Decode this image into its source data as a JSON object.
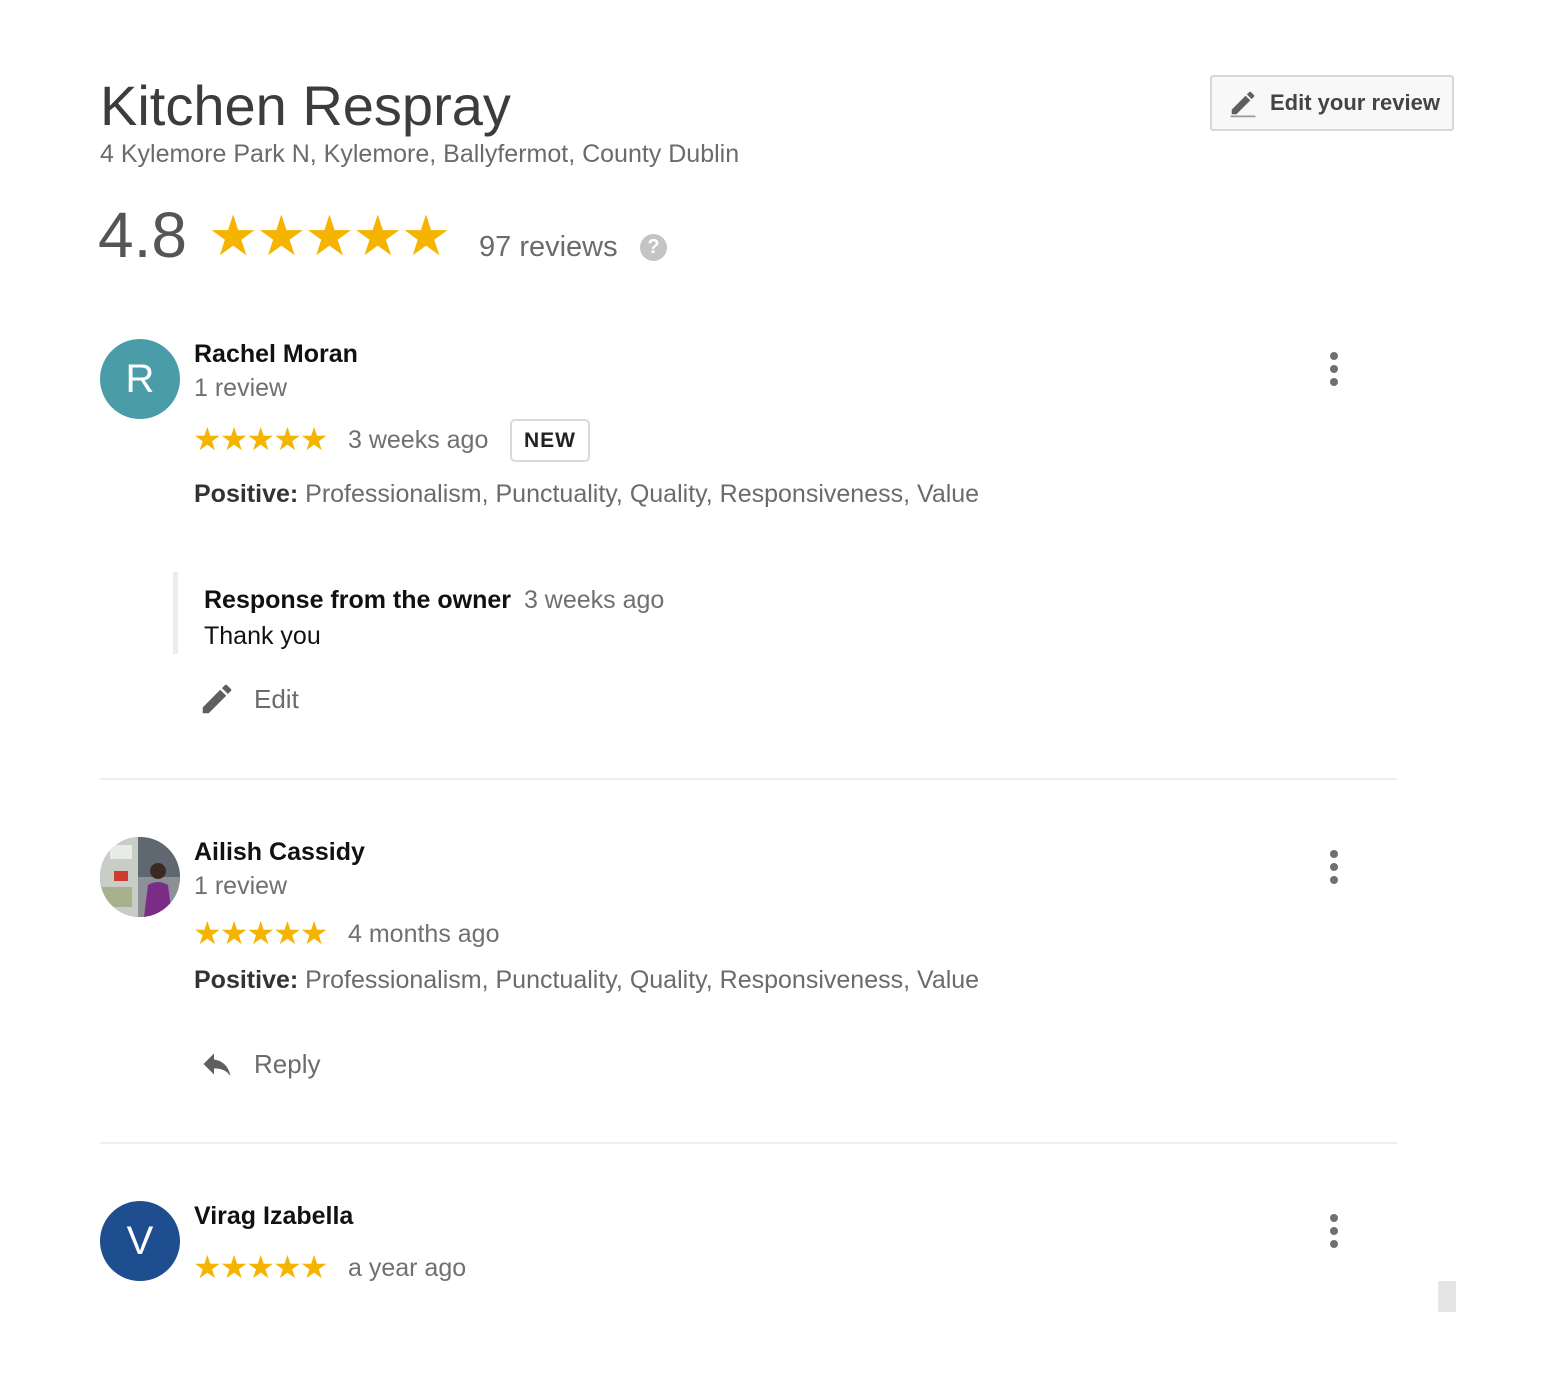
{
  "business": {
    "name": "Kitchen Respray",
    "address": "4 Kylemore Park N, Kylemore, Ballyfermot, County Dublin",
    "rating": "4.8",
    "rating_value": 4.8,
    "stars": "★★★★★",
    "review_count_label": "97 reviews",
    "help_glyph": "?"
  },
  "edit_review_button": {
    "label": "Edit your review",
    "icon": "pencil-icon"
  },
  "colors": {
    "star": "#f4b400",
    "avatar_r": "#4a9da8",
    "avatar_v": "#1e4e8f"
  },
  "reviews": [
    {
      "avatar_letter": "R",
      "name": "Rachel Moran",
      "review_count": "1 review",
      "stars": "★★★★★",
      "time": "3 weeks ago",
      "badge": "NEW",
      "positive_label": "Positive:",
      "positive_items": "Professionalism, Punctuality, Quality, Responsiveness, Value",
      "owner_response": {
        "title": "Response from the owner",
        "time": "3 weeks ago",
        "text": "Thank you"
      },
      "action_label": "Edit"
    },
    {
      "avatar_letter": "",
      "name": "Ailish Cassidy",
      "review_count": "1 review",
      "stars": "★★★★★",
      "time": "4 months ago",
      "positive_label": "Positive:",
      "positive_items": "Professionalism, Punctuality, Quality, Responsiveness, Value",
      "action_label": "Reply"
    },
    {
      "avatar_letter": "V",
      "name": "Virag Izabella",
      "stars": "★★★★★",
      "time": "a year ago"
    }
  ]
}
